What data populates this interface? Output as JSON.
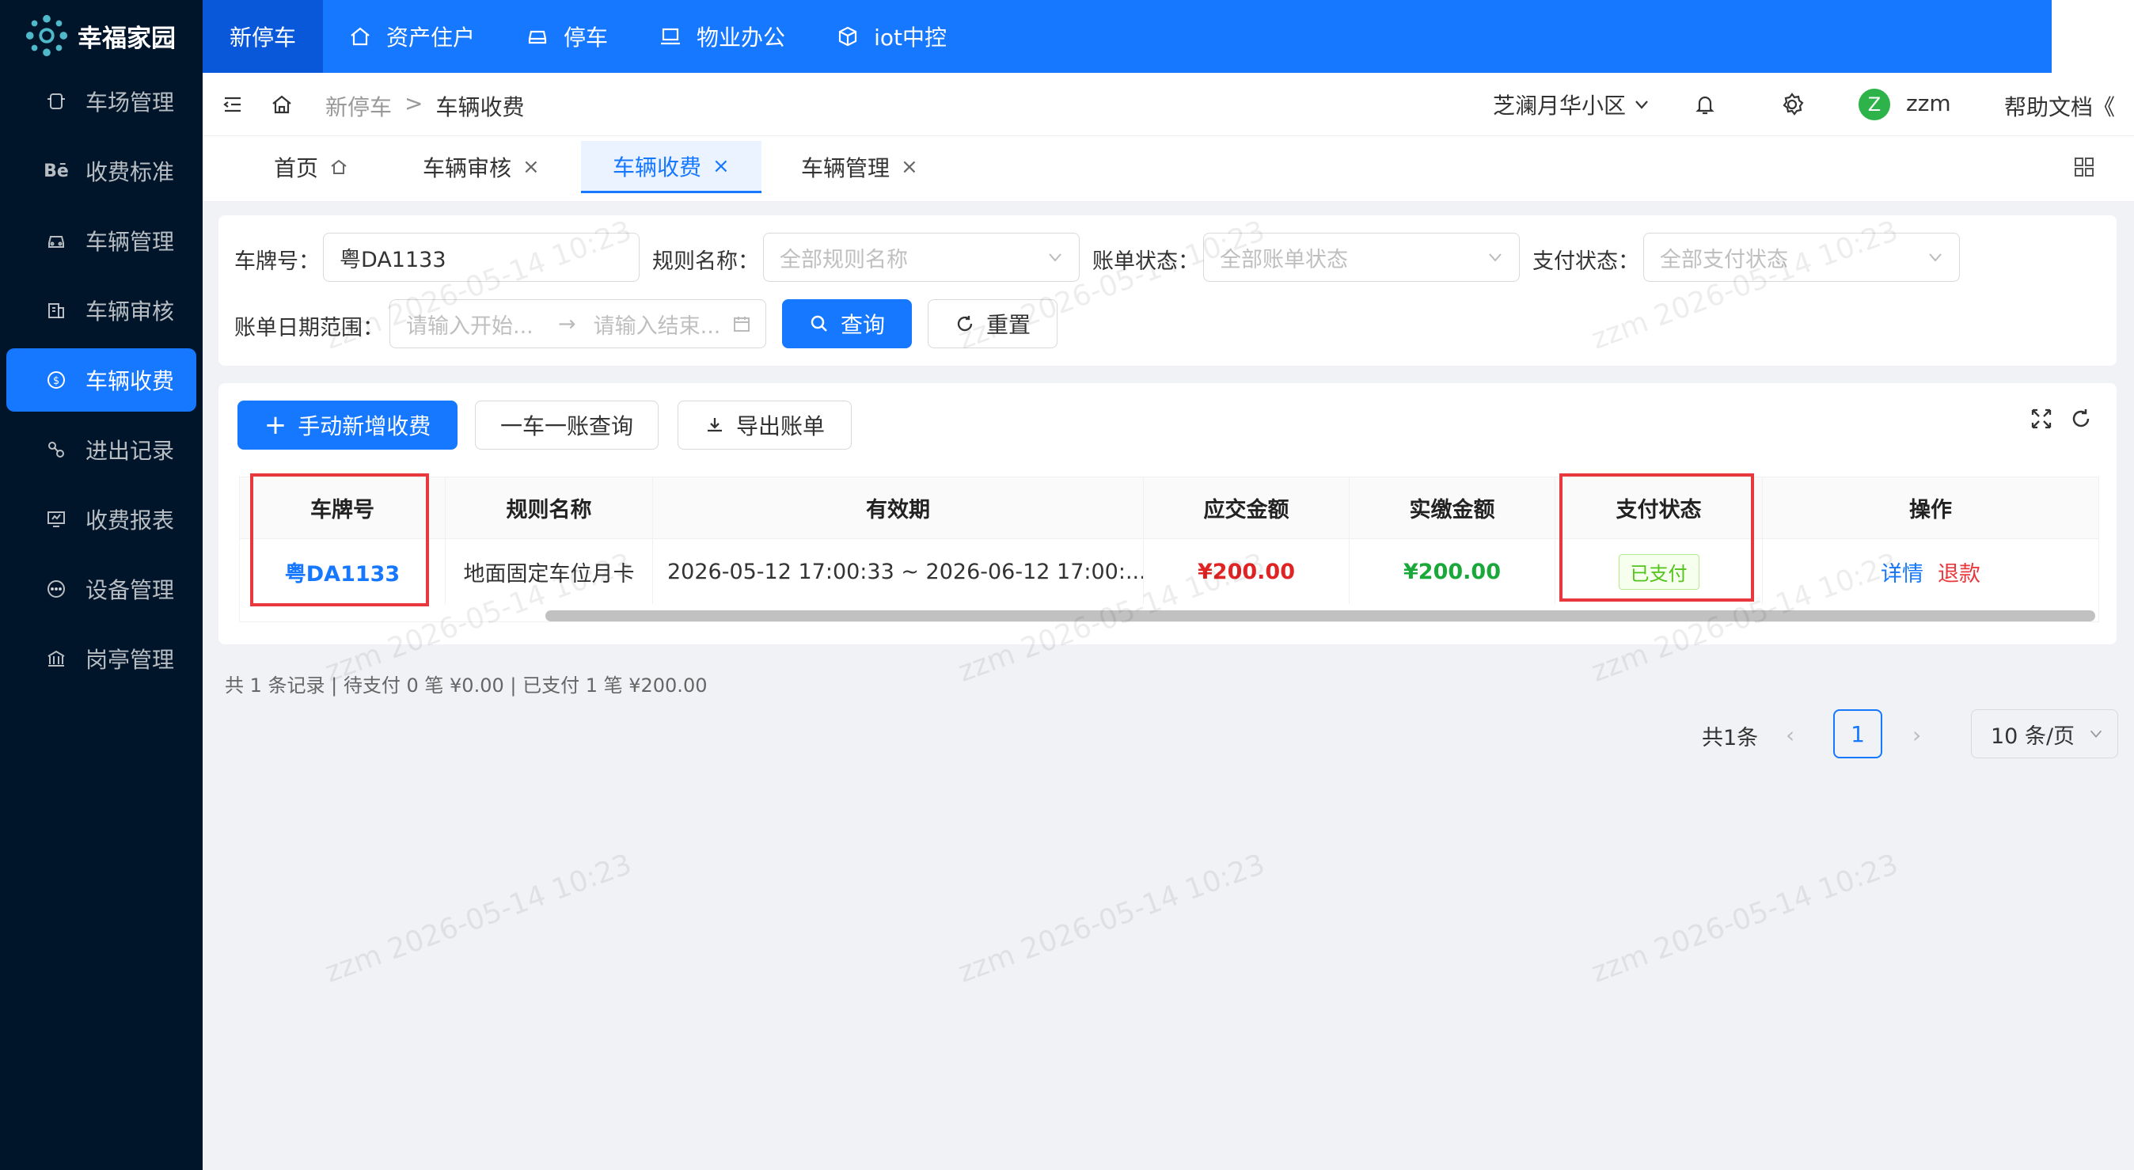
{
  "app": {
    "title": "幸福家园"
  },
  "sidebar": {
    "items": [
      {
        "label": "车场管理",
        "icon": "parking-lot-icon"
      },
      {
        "label": "收费标准",
        "icon": "behance-icon"
      },
      {
        "label": "车辆管理",
        "icon": "car-icon"
      },
      {
        "label": "车辆审核",
        "icon": "audit-icon"
      },
      {
        "label": "车辆收费",
        "icon": "dollar-circle-icon",
        "active": true
      },
      {
        "label": "进出记录",
        "icon": "record-icon"
      },
      {
        "label": "收费报表",
        "icon": "report-icon"
      },
      {
        "label": "设备管理",
        "icon": "device-icon"
      },
      {
        "label": "岗亭管理",
        "icon": "booth-icon"
      }
    ]
  },
  "topnav": {
    "items": [
      {
        "label": "新停车",
        "active": true
      },
      {
        "label": "资产住户",
        "icon": "home-icon"
      },
      {
        "label": "停车",
        "icon": "car-icon"
      },
      {
        "label": "物业办公",
        "icon": "laptop-icon"
      },
      {
        "label": "iot中控",
        "icon": "cube-icon"
      }
    ]
  },
  "header": {
    "breadcrumb": {
      "parent": "新停车",
      "sep": ">",
      "current": "车辆收费"
    },
    "community": "芝澜月华小区",
    "avatar_letter": "Z",
    "username": "zzm",
    "help": "帮助文档"
  },
  "tabs": [
    {
      "label": "首页"
    },
    {
      "label": "车辆审核"
    },
    {
      "label": "车辆收费",
      "active": true
    },
    {
      "label": "车辆管理"
    }
  ],
  "filters": {
    "plate_label": "车牌号：",
    "plate_value": "粤DA1133",
    "rule_label": "规则名称：",
    "rule_placeholder": "全部规则名称",
    "bill_status_label": "账单状态：",
    "bill_status_placeholder": "全部账单状态",
    "pay_status_label": "支付状态：",
    "pay_status_placeholder": "全部支付状态",
    "date_label": "账单日期范围：",
    "date_start_placeholder": "请输入开始...",
    "date_end_placeholder": "请输入结束...",
    "query_btn": "查询",
    "reset_btn": "重置"
  },
  "toolbar": {
    "add_btn": "手动新增收费",
    "car_query_btn": "一车一账查询",
    "export_btn": "导出账单"
  },
  "table": {
    "columns": [
      "车牌号",
      "规则名称",
      "有效期",
      "应交金额",
      "实缴金额",
      "支付状态",
      "操作"
    ],
    "rows": [
      {
        "plate": "粤DA1133",
        "rule": "地面固定车位月卡",
        "period": "2026-05-12 17:00:33 ~ 2026-06-12 17:00:...",
        "due": "¥200.00",
        "paid": "¥200.00",
        "status": "已支付",
        "action_detail": "详情",
        "action_refund": "退款"
      }
    ]
  },
  "summary": "共 1 条记录 | 待支付 0 笔 ¥0.00 | 已支付 1 笔 ¥200.00",
  "pagination": {
    "total": "共1条",
    "current": "1",
    "page_size": "10 条/页"
  },
  "watermark": "zzm 2026-05-14 10:23",
  "colors": {
    "primary": "#1677ff",
    "sidebar": "#001529",
    "danger": "#e8383d",
    "success": "#1aa83a"
  }
}
